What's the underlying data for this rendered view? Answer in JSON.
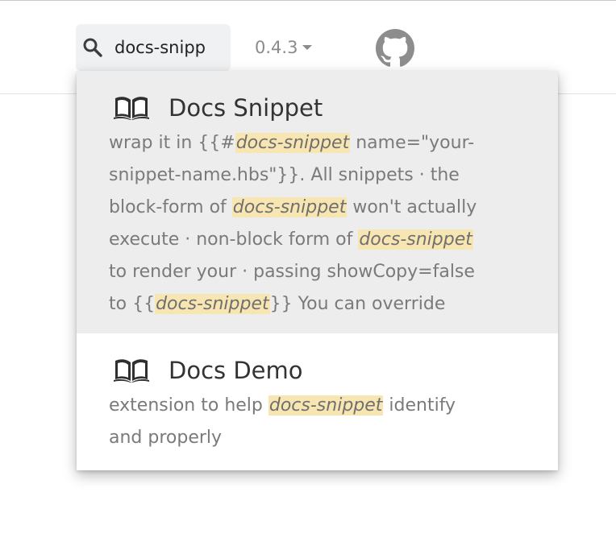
{
  "search": {
    "value": "docs-snipp",
    "icon": "search-icon"
  },
  "version": {
    "label": "0.4.3",
    "icon": "caret-down-icon"
  },
  "header": {
    "github_icon": "github-icon"
  },
  "results": [
    {
      "title": "Docs Snippet",
      "icon": "book-icon",
      "active": true,
      "lines": [
        [
          {
            "t": "wrap it in {{#"
          },
          {
            "t": "docs-snippet",
            "hl": true
          },
          {
            "t": " name=\"your-"
          }
        ],
        [
          {
            "t": "snippet-name.hbs\"}}. All snippets · the"
          }
        ],
        [
          {
            "t": "block-form of "
          },
          {
            "t": "docs-snippet",
            "hl": true
          },
          {
            "t": " won't actually"
          }
        ],
        [
          {
            "t": "execute · non-block form of "
          },
          {
            "t": "docs-snippet",
            "hl": true
          }
        ],
        [
          {
            "t": "to render your · passing showCopy=false"
          }
        ],
        [
          {
            "t": "to {{"
          },
          {
            "t": "docs-snippet",
            "hl": true
          },
          {
            "t": "}} You can override"
          }
        ]
      ]
    },
    {
      "title": "Docs Demo",
      "icon": "book-icon",
      "active": false,
      "lines": [
        [
          {
            "t": "extension to help "
          },
          {
            "t": "docs-snippet",
            "hl": true
          },
          {
            "t": " identify"
          }
        ],
        [
          {
            "t": "and properly"
          }
        ]
      ]
    }
  ],
  "colors": {
    "highlight": "#f8e6b2",
    "active_row": "#ededed",
    "search_bg": "#eff1f3"
  }
}
